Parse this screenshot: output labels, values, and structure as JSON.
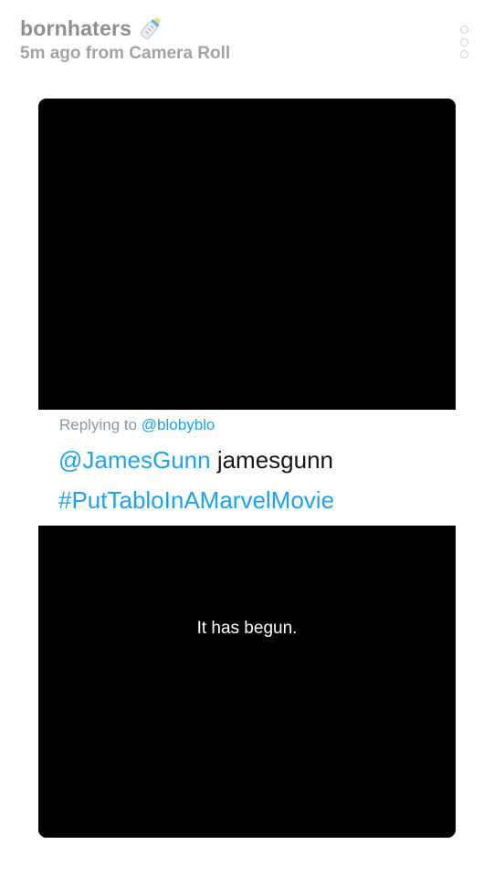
{
  "header": {
    "username": "bornhaters",
    "username_emoji_icon": "baby-bottle-icon",
    "timestamp": "5m ago from Camera Roll",
    "more_icon": "vertical-dots-icon"
  },
  "snap": {
    "tweet": {
      "replying_prefix": "Replying to",
      "replying_handle": "@blobyblo",
      "mention": "@JamesGunn",
      "text": "jamesgunn",
      "hashtag": "#PutTabloInAMarvelMovie"
    },
    "caption": "It has begun."
  },
  "colors": {
    "link_blue": "#1da1f2",
    "muted_gray": "#8899a6",
    "header_gray": "#8e8e93",
    "media_background": "#000000"
  }
}
